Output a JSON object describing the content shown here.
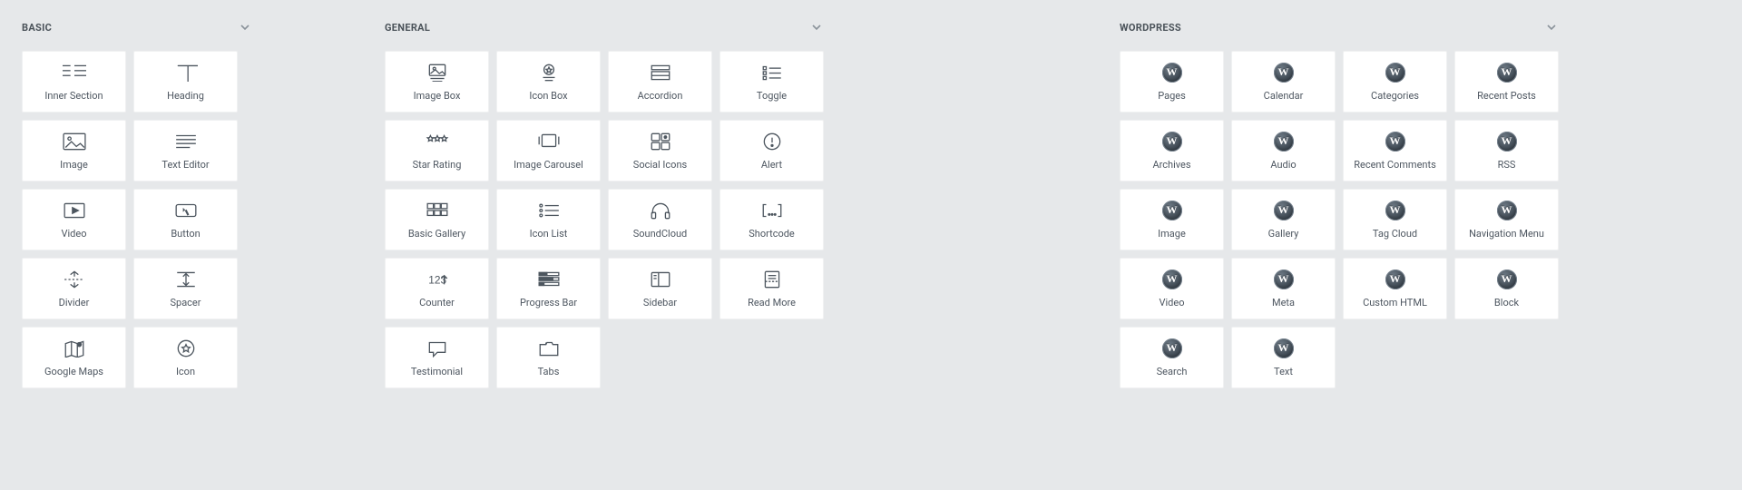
{
  "panels": {
    "basic": {
      "title": "BASIC",
      "widgets": [
        {
          "id": "inner-section",
          "label": "Inner Section",
          "icon": "inner-section"
        },
        {
          "id": "heading",
          "label": "Heading",
          "icon": "heading"
        },
        {
          "id": "image",
          "label": "Image",
          "icon": "image"
        },
        {
          "id": "text-editor",
          "label": "Text Editor",
          "icon": "text-editor"
        },
        {
          "id": "video",
          "label": "Video",
          "icon": "video"
        },
        {
          "id": "button",
          "label": "Button",
          "icon": "button"
        },
        {
          "id": "divider",
          "label": "Divider",
          "icon": "divider"
        },
        {
          "id": "spacer",
          "label": "Spacer",
          "icon": "spacer"
        },
        {
          "id": "google-maps",
          "label": "Google Maps",
          "icon": "maps"
        },
        {
          "id": "icon",
          "label": "Icon",
          "icon": "star-circle"
        }
      ]
    },
    "general": {
      "title": "GENERAL",
      "widgets": [
        {
          "id": "image-box",
          "label": "Image Box",
          "icon": "image-box"
        },
        {
          "id": "icon-box",
          "label": "Icon Box",
          "icon": "icon-box"
        },
        {
          "id": "accordion",
          "label": "Accordion",
          "icon": "accordion"
        },
        {
          "id": "toggle",
          "label": "Toggle",
          "icon": "toggle"
        },
        {
          "id": "star-rating",
          "label": "Star Rating",
          "icon": "stars"
        },
        {
          "id": "image-carousel",
          "label": "Image Carousel",
          "icon": "carousel"
        },
        {
          "id": "social-icons",
          "label": "Social Icons",
          "icon": "social"
        },
        {
          "id": "alert",
          "label": "Alert",
          "icon": "alert"
        },
        {
          "id": "basic-gallery",
          "label": "Basic Gallery",
          "icon": "gallery"
        },
        {
          "id": "icon-list",
          "label": "Icon List",
          "icon": "icon-list"
        },
        {
          "id": "soundcloud",
          "label": "SoundCloud",
          "icon": "headphones"
        },
        {
          "id": "shortcode",
          "label": "Shortcode",
          "icon": "shortcode"
        },
        {
          "id": "counter",
          "label": "Counter",
          "icon": "counter"
        },
        {
          "id": "progress-bar",
          "label": "Progress Bar",
          "icon": "progress"
        },
        {
          "id": "sidebar",
          "label": "Sidebar",
          "icon": "sidebar"
        },
        {
          "id": "read-more",
          "label": "Read More",
          "icon": "readmore"
        },
        {
          "id": "testimonial",
          "label": "Testimonial",
          "icon": "testimonial"
        },
        {
          "id": "tabs",
          "label": "Tabs",
          "icon": "tabs"
        }
      ]
    },
    "wordpress": {
      "title": "WORDPRESS",
      "widgets": [
        {
          "id": "wp-pages",
          "label": "Pages"
        },
        {
          "id": "wp-calendar",
          "label": "Calendar"
        },
        {
          "id": "wp-categories",
          "label": "Categories"
        },
        {
          "id": "wp-recent-posts",
          "label": "Recent Posts"
        },
        {
          "id": "wp-archives",
          "label": "Archives"
        },
        {
          "id": "wp-audio",
          "label": "Audio"
        },
        {
          "id": "wp-recent-comments",
          "label": "Recent Comments"
        },
        {
          "id": "wp-rss",
          "label": "RSS"
        },
        {
          "id": "wp-image",
          "label": "Image"
        },
        {
          "id": "wp-gallery",
          "label": "Gallery"
        },
        {
          "id": "wp-tag-cloud",
          "label": "Tag Cloud"
        },
        {
          "id": "wp-nav-menu",
          "label": "Navigation Menu"
        },
        {
          "id": "wp-video",
          "label": "Video"
        },
        {
          "id": "wp-meta",
          "label": "Meta"
        },
        {
          "id": "wp-custom-html",
          "label": "Custom HTML"
        },
        {
          "id": "wp-block",
          "label": "Block"
        },
        {
          "id": "wp-search",
          "label": "Search"
        },
        {
          "id": "wp-text",
          "label": "Text"
        }
      ]
    }
  }
}
